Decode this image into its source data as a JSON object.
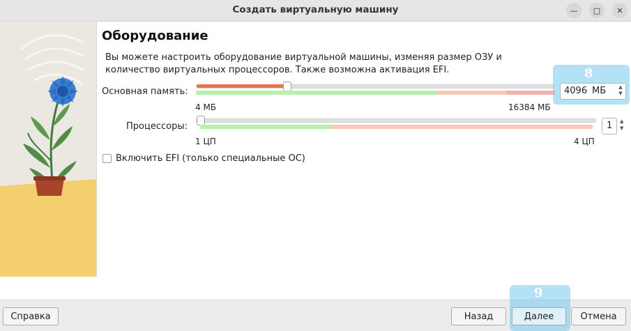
{
  "window": {
    "title": "Создать виртуальную машину",
    "minimize_glyph": "—",
    "maximize_glyph": "□",
    "close_glyph": "✕"
  },
  "page": {
    "heading": "Оборудование",
    "description": "Вы можете настроить оборудование виртуальной машины, изменяя размер ОЗУ и количество виртуальных процессоров. Также возможна активация EFI."
  },
  "memory": {
    "label": "Основная память:",
    "min_label": "4 МБ",
    "max_label": "16384 МБ",
    "value": "4096",
    "unit": "МБ",
    "level": 0.25
  },
  "cpu": {
    "label": "Процессоры:",
    "min_label": "1 ЦП",
    "max_label": "4 ЦП",
    "value": "1",
    "level": 0.0
  },
  "efi": {
    "label": "Включить EFI (только специальные ОС)",
    "checked": false
  },
  "annotations": {
    "memory_callout": "8",
    "next_callout": "9"
  },
  "footer": {
    "help": "Справка",
    "back": "Назад",
    "next": "Далее",
    "cancel": "Отмена"
  },
  "colors": {
    "slider_fill": "#e8734f",
    "safe_zone": "#b9f0b0",
    "warn_zone": "#f9c7b6",
    "danger_zone": "#f3b2b2",
    "callout": "#78c8f0"
  }
}
